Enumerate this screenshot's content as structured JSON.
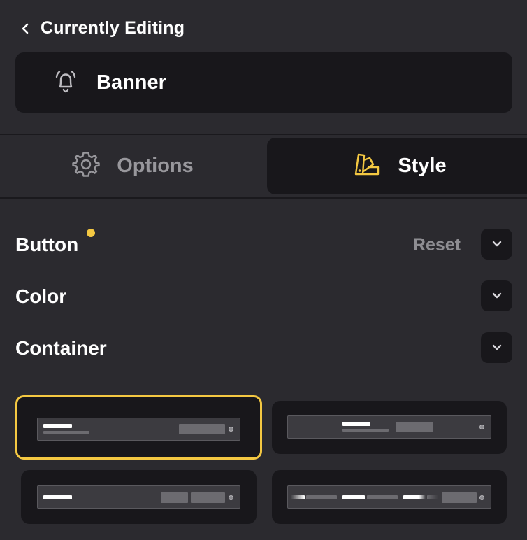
{
  "header": {
    "back_label": "Currently Editing",
    "component_name": "Banner",
    "component_icon": "bell-icon"
  },
  "tabs": [
    {
      "label": "Options",
      "icon": "gear-icon",
      "active": false
    },
    {
      "label": "Style",
      "icon": "palette-swatch-icon",
      "active": true
    }
  ],
  "sections": [
    {
      "title": "Button",
      "modified": true,
      "reset_label": "Reset"
    },
    {
      "title": "Color",
      "modified": false
    },
    {
      "title": "Container",
      "modified": false
    }
  ],
  "layouts": {
    "selected_index": 0,
    "count": 4
  },
  "colors": {
    "accent": "#f4c842",
    "panel_bg": "#2b2a2f",
    "card_bg": "#18171b",
    "muted_text": "#98979c"
  }
}
